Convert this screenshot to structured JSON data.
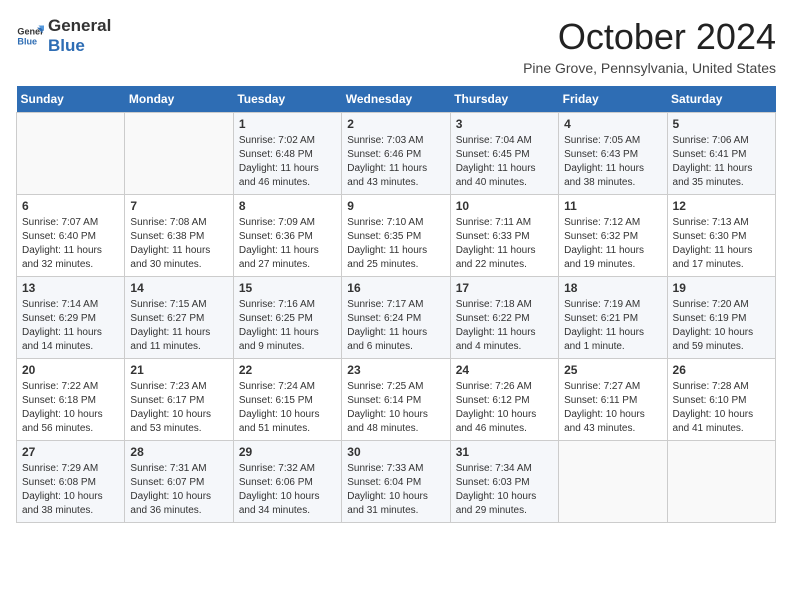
{
  "logo": {
    "line1": "General",
    "line2": "Blue"
  },
  "title": "October 2024",
  "subtitle": "Pine Grove, Pennsylvania, United States",
  "weekdays": [
    "Sunday",
    "Monday",
    "Tuesday",
    "Wednesday",
    "Thursday",
    "Friday",
    "Saturday"
  ],
  "weeks": [
    [
      {
        "day": "",
        "info": ""
      },
      {
        "day": "",
        "info": ""
      },
      {
        "day": "1",
        "info": "Sunrise: 7:02 AM\nSunset: 6:48 PM\nDaylight: 11 hours and 46 minutes."
      },
      {
        "day": "2",
        "info": "Sunrise: 7:03 AM\nSunset: 6:46 PM\nDaylight: 11 hours and 43 minutes."
      },
      {
        "day": "3",
        "info": "Sunrise: 7:04 AM\nSunset: 6:45 PM\nDaylight: 11 hours and 40 minutes."
      },
      {
        "day": "4",
        "info": "Sunrise: 7:05 AM\nSunset: 6:43 PM\nDaylight: 11 hours and 38 minutes."
      },
      {
        "day": "5",
        "info": "Sunrise: 7:06 AM\nSunset: 6:41 PM\nDaylight: 11 hours and 35 minutes."
      }
    ],
    [
      {
        "day": "6",
        "info": "Sunrise: 7:07 AM\nSunset: 6:40 PM\nDaylight: 11 hours and 32 minutes."
      },
      {
        "day": "7",
        "info": "Sunrise: 7:08 AM\nSunset: 6:38 PM\nDaylight: 11 hours and 30 minutes."
      },
      {
        "day": "8",
        "info": "Sunrise: 7:09 AM\nSunset: 6:36 PM\nDaylight: 11 hours and 27 minutes."
      },
      {
        "day": "9",
        "info": "Sunrise: 7:10 AM\nSunset: 6:35 PM\nDaylight: 11 hours and 25 minutes."
      },
      {
        "day": "10",
        "info": "Sunrise: 7:11 AM\nSunset: 6:33 PM\nDaylight: 11 hours and 22 minutes."
      },
      {
        "day": "11",
        "info": "Sunrise: 7:12 AM\nSunset: 6:32 PM\nDaylight: 11 hours and 19 minutes."
      },
      {
        "day": "12",
        "info": "Sunrise: 7:13 AM\nSunset: 6:30 PM\nDaylight: 11 hours and 17 minutes."
      }
    ],
    [
      {
        "day": "13",
        "info": "Sunrise: 7:14 AM\nSunset: 6:29 PM\nDaylight: 11 hours and 14 minutes."
      },
      {
        "day": "14",
        "info": "Sunrise: 7:15 AM\nSunset: 6:27 PM\nDaylight: 11 hours and 11 minutes."
      },
      {
        "day": "15",
        "info": "Sunrise: 7:16 AM\nSunset: 6:25 PM\nDaylight: 11 hours and 9 minutes."
      },
      {
        "day": "16",
        "info": "Sunrise: 7:17 AM\nSunset: 6:24 PM\nDaylight: 11 hours and 6 minutes."
      },
      {
        "day": "17",
        "info": "Sunrise: 7:18 AM\nSunset: 6:22 PM\nDaylight: 11 hours and 4 minutes."
      },
      {
        "day": "18",
        "info": "Sunrise: 7:19 AM\nSunset: 6:21 PM\nDaylight: 11 hours and 1 minute."
      },
      {
        "day": "19",
        "info": "Sunrise: 7:20 AM\nSunset: 6:19 PM\nDaylight: 10 hours and 59 minutes."
      }
    ],
    [
      {
        "day": "20",
        "info": "Sunrise: 7:22 AM\nSunset: 6:18 PM\nDaylight: 10 hours and 56 minutes."
      },
      {
        "day": "21",
        "info": "Sunrise: 7:23 AM\nSunset: 6:17 PM\nDaylight: 10 hours and 53 minutes."
      },
      {
        "day": "22",
        "info": "Sunrise: 7:24 AM\nSunset: 6:15 PM\nDaylight: 10 hours and 51 minutes."
      },
      {
        "day": "23",
        "info": "Sunrise: 7:25 AM\nSunset: 6:14 PM\nDaylight: 10 hours and 48 minutes."
      },
      {
        "day": "24",
        "info": "Sunrise: 7:26 AM\nSunset: 6:12 PM\nDaylight: 10 hours and 46 minutes."
      },
      {
        "day": "25",
        "info": "Sunrise: 7:27 AM\nSunset: 6:11 PM\nDaylight: 10 hours and 43 minutes."
      },
      {
        "day": "26",
        "info": "Sunrise: 7:28 AM\nSunset: 6:10 PM\nDaylight: 10 hours and 41 minutes."
      }
    ],
    [
      {
        "day": "27",
        "info": "Sunrise: 7:29 AM\nSunset: 6:08 PM\nDaylight: 10 hours and 38 minutes."
      },
      {
        "day": "28",
        "info": "Sunrise: 7:31 AM\nSunset: 6:07 PM\nDaylight: 10 hours and 36 minutes."
      },
      {
        "day": "29",
        "info": "Sunrise: 7:32 AM\nSunset: 6:06 PM\nDaylight: 10 hours and 34 minutes."
      },
      {
        "day": "30",
        "info": "Sunrise: 7:33 AM\nSunset: 6:04 PM\nDaylight: 10 hours and 31 minutes."
      },
      {
        "day": "31",
        "info": "Sunrise: 7:34 AM\nSunset: 6:03 PM\nDaylight: 10 hours and 29 minutes."
      },
      {
        "day": "",
        "info": ""
      },
      {
        "day": "",
        "info": ""
      }
    ]
  ]
}
